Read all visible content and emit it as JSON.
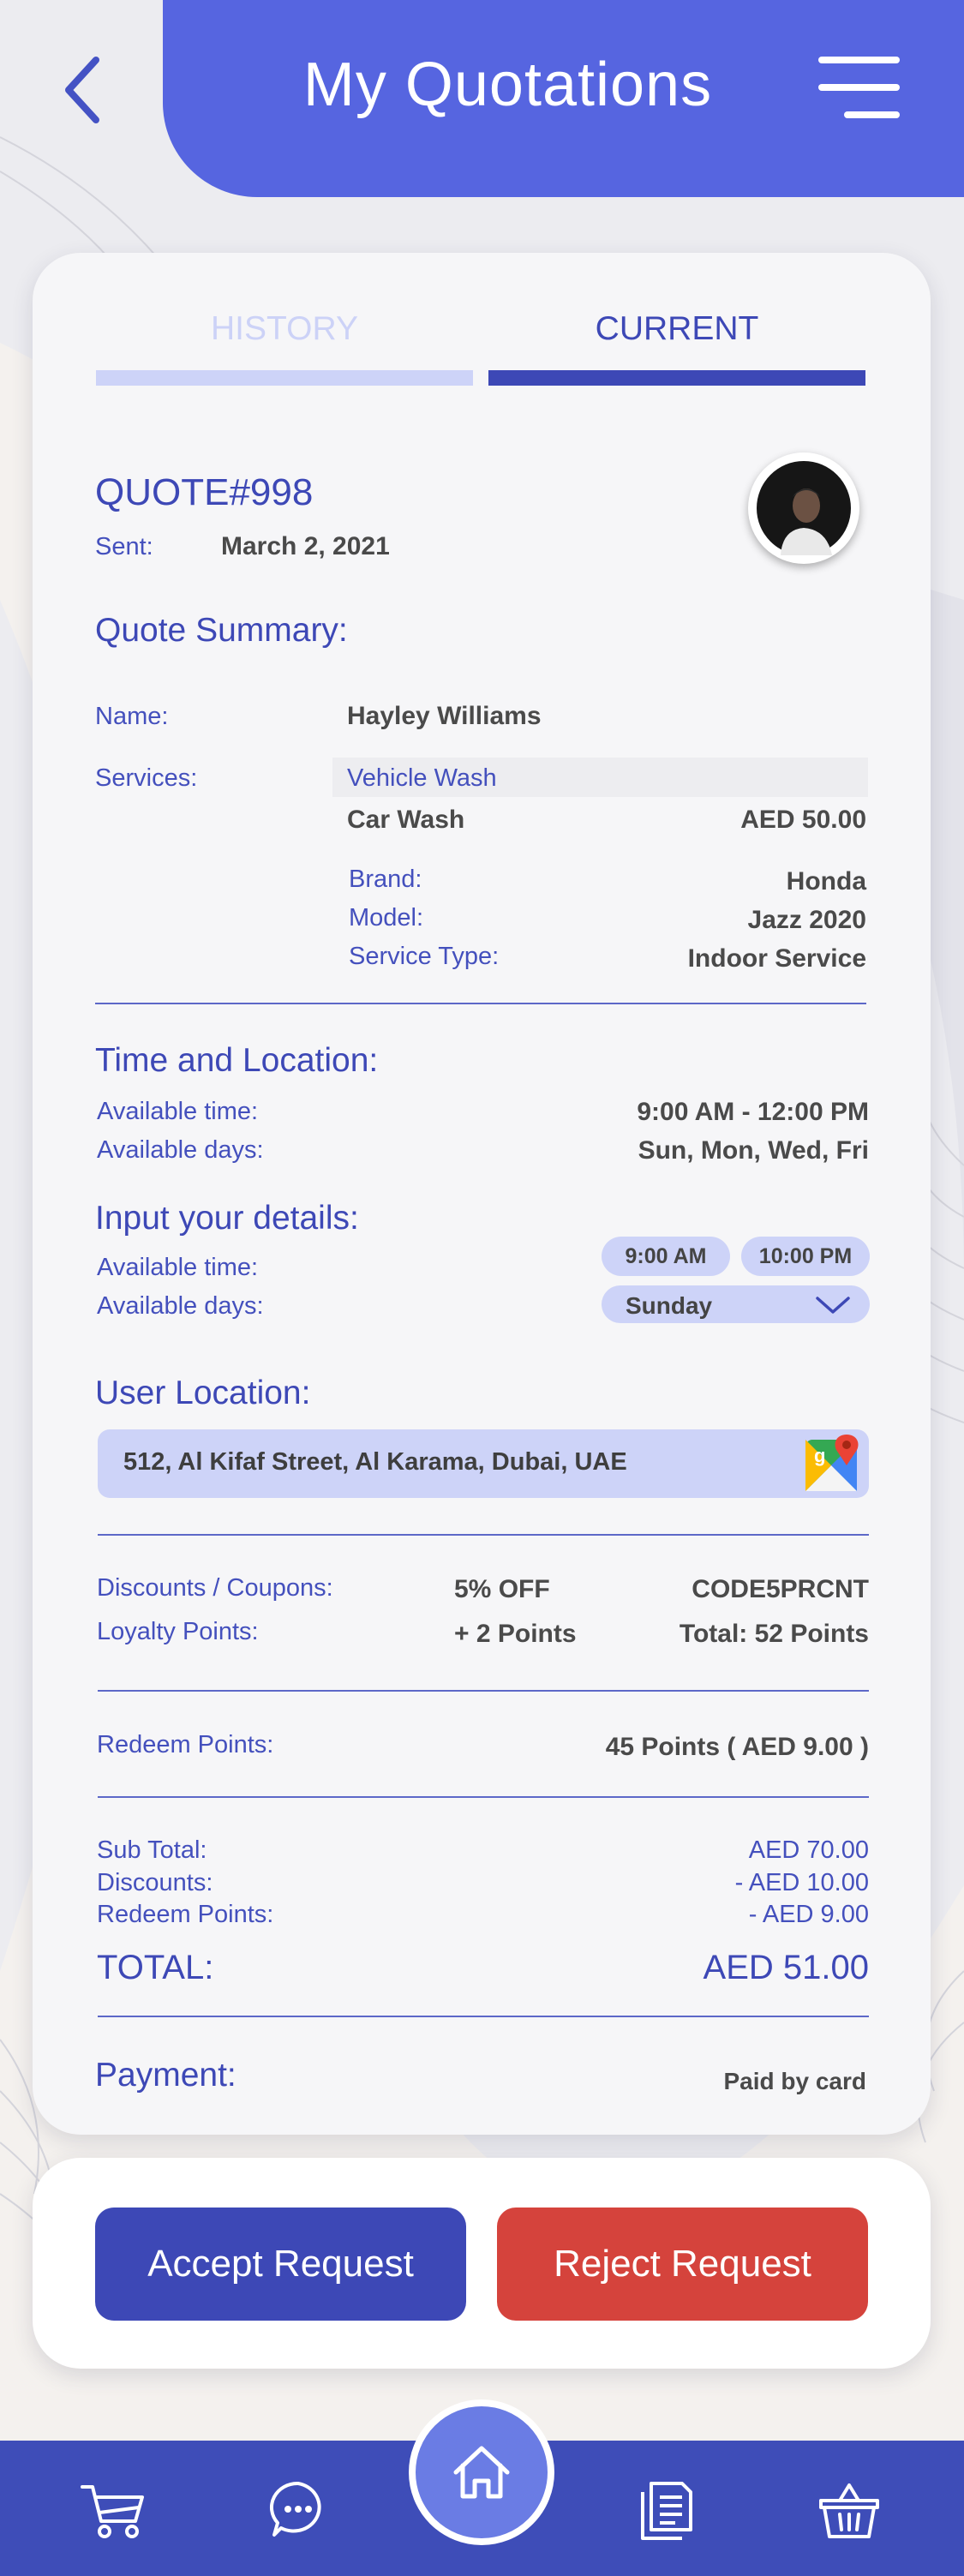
{
  "header": {
    "title": "My Quotations"
  },
  "tabs": [
    {
      "label": "HISTORY",
      "active": false
    },
    {
      "label": "CURRENT",
      "active": true
    }
  ],
  "quote": {
    "number": "QUOTE#998",
    "sent_label": "Sent:",
    "sent_date": "March 2, 2021"
  },
  "summary": {
    "heading": "Quote Summary:",
    "name_label": "Name:",
    "name_value": "Hayley Williams",
    "services_label": "Services:",
    "service_category": "Vehicle Wash",
    "service_name": "Car Wash",
    "service_price": "AED 50.00",
    "brand_label": "Brand:",
    "brand_value": "Honda",
    "model_label": "Model:",
    "model_value": "Jazz 2020",
    "service_type_label": "Service Type:",
    "service_type_value": "Indoor Service"
  },
  "time_location": {
    "heading": "Time and Location:",
    "time_label": "Available time:",
    "time_value": "9:00 AM - 12:00 PM",
    "days_label": "Available days:",
    "days_value": "Sun, Mon, Wed, Fri"
  },
  "input_details": {
    "heading": "Input your details:",
    "time_label": "Available time:",
    "time_from": "9:00 AM",
    "time_to": "10:00 PM",
    "days_label": "Available days:",
    "day_selected": "Sunday"
  },
  "location": {
    "heading": "User Location:",
    "address": "512, Al Kifaf Street, Al Karama, Dubai, UAE"
  },
  "discounts": {
    "coupons_label": "Discounts / Coupons:",
    "coupon_value": "5% OFF",
    "coupon_code": "CODE5PRCNT",
    "loyalty_label": "Loyalty Points:",
    "loyalty_points": "+ 2 Points",
    "loyalty_total": "Total:  52 Points"
  },
  "redeem": {
    "label": "Redeem Points:",
    "value": "45 Points ( AED 9.00 )"
  },
  "totals": {
    "subtotal_label": "Sub Total:",
    "subtotal_value": "AED 70.00",
    "discounts_label": "Discounts:",
    "discounts_value": "- AED 10.00",
    "redeem_label": "Redeem Points:",
    "redeem_value": "- AED 9.00",
    "total_label": "TOTAL:",
    "total_value": "AED 51.00"
  },
  "payment": {
    "label": "Payment:",
    "value": "Paid by card"
  },
  "actions": {
    "accept": "Accept Request",
    "reject": "Reject Request"
  },
  "colors": {
    "primary": "#5665e0",
    "dark_primary": "#3e4db8",
    "accept": "#3d48b6",
    "reject": "#d5433c",
    "tab_inactive": "#ccd2f7"
  },
  "icons": [
    "back-chevron-icon",
    "hamburger-menu-icon",
    "google-maps-icon",
    "cart-icon",
    "chat-icon",
    "home-icon",
    "documents-icon",
    "basket-icon"
  ]
}
